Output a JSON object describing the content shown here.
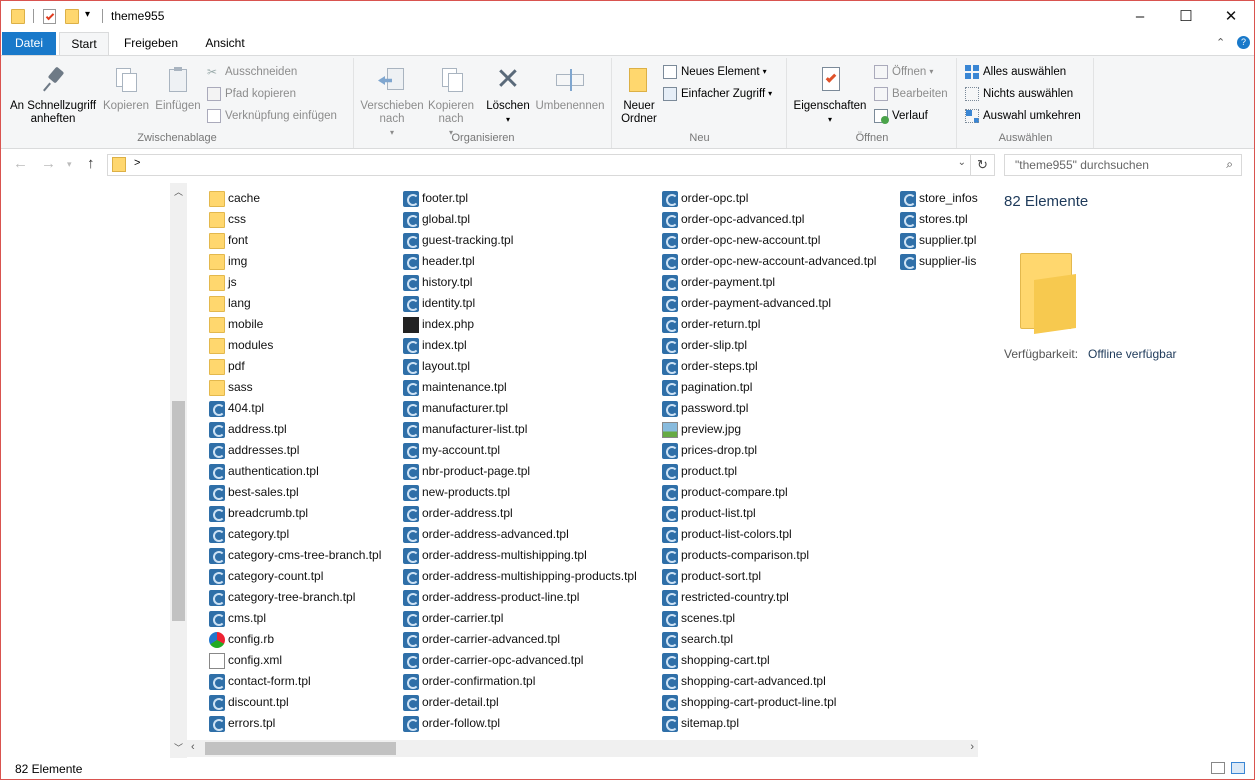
{
  "window": {
    "title": "theme955",
    "minimize": "–",
    "maximize": "☐",
    "close": "✕"
  },
  "tabs": {
    "file": "Datei",
    "start": "Start",
    "share": "Freigeben",
    "view": "Ansicht"
  },
  "ribbon": {
    "clipboard": {
      "label": "Zwischenablage",
      "pin": "An Schnellzugriff anheften",
      "copy": "Kopieren",
      "paste": "Einfügen",
      "cut": "Ausschneiden",
      "copy_path": "Pfad kopieren",
      "paste_shortcut": "Verknüpfung einfügen"
    },
    "organize": {
      "label": "Organisieren",
      "move": "Verschieben nach",
      "copyto": "Kopieren nach",
      "delete": "Löschen",
      "rename": "Umbenennen"
    },
    "new": {
      "label": "Neu",
      "folder": "Neuer Ordner",
      "new_item": "Neues Element",
      "easy_access": "Einfacher Zugriff"
    },
    "open": {
      "label": "Öffnen",
      "properties": "Eigenschaften",
      "open": "Öffnen",
      "edit": "Bearbeiten",
      "history": "Verlauf"
    },
    "select": {
      "label": "Auswählen",
      "all": "Alles auswählen",
      "none": "Nichts auswählen",
      "invert": "Auswahl umkehren"
    }
  },
  "address": {
    "path": ">",
    "search_placeholder": "\"theme955\" durchsuchen"
  },
  "files": {
    "col1": [
      {
        "name": "cache",
        "type": "folder"
      },
      {
        "name": "css",
        "type": "folder"
      },
      {
        "name": "font",
        "type": "folder"
      },
      {
        "name": "img",
        "type": "folder"
      },
      {
        "name": "js",
        "type": "folder"
      },
      {
        "name": "lang",
        "type": "folder"
      },
      {
        "name": "mobile",
        "type": "folder"
      },
      {
        "name": "modules",
        "type": "folder"
      },
      {
        "name": "pdf",
        "type": "folder"
      },
      {
        "name": "sass",
        "type": "folder"
      },
      {
        "name": "404.tpl",
        "type": "tpl"
      },
      {
        "name": "address.tpl",
        "type": "tpl"
      },
      {
        "name": "addresses.tpl",
        "type": "tpl"
      },
      {
        "name": "authentication.tpl",
        "type": "tpl"
      },
      {
        "name": "best-sales.tpl",
        "type": "tpl"
      },
      {
        "name": "breadcrumb.tpl",
        "type": "tpl"
      },
      {
        "name": "category.tpl",
        "type": "tpl"
      },
      {
        "name": "category-cms-tree-branch.tpl",
        "type": "tpl"
      },
      {
        "name": "category-count.tpl",
        "type": "tpl"
      },
      {
        "name": "category-tree-branch.tpl",
        "type": "tpl"
      },
      {
        "name": "cms.tpl",
        "type": "tpl"
      },
      {
        "name": "config.rb",
        "type": "rb"
      },
      {
        "name": "config.xml",
        "type": "xml"
      },
      {
        "name": "contact-form.tpl",
        "type": "tpl"
      },
      {
        "name": "discount.tpl",
        "type": "tpl"
      },
      {
        "name": "errors.tpl",
        "type": "tpl"
      }
    ],
    "col2": [
      {
        "name": "footer.tpl",
        "type": "tpl"
      },
      {
        "name": "global.tpl",
        "type": "tpl"
      },
      {
        "name": "guest-tracking.tpl",
        "type": "tpl"
      },
      {
        "name": "header.tpl",
        "type": "tpl"
      },
      {
        "name": "history.tpl",
        "type": "tpl"
      },
      {
        "name": "identity.tpl",
        "type": "tpl"
      },
      {
        "name": "index.php",
        "type": "php"
      },
      {
        "name": "index.tpl",
        "type": "tpl"
      },
      {
        "name": "layout.tpl",
        "type": "tpl"
      },
      {
        "name": "maintenance.tpl",
        "type": "tpl"
      },
      {
        "name": "manufacturer.tpl",
        "type": "tpl"
      },
      {
        "name": "manufacturer-list.tpl",
        "type": "tpl"
      },
      {
        "name": "my-account.tpl",
        "type": "tpl"
      },
      {
        "name": "nbr-product-page.tpl",
        "type": "tpl"
      },
      {
        "name": "new-products.tpl",
        "type": "tpl"
      },
      {
        "name": "order-address.tpl",
        "type": "tpl"
      },
      {
        "name": "order-address-advanced.tpl",
        "type": "tpl"
      },
      {
        "name": "order-address-multishipping.tpl",
        "type": "tpl"
      },
      {
        "name": "order-address-multishipping-products.tpl",
        "type": "tpl"
      },
      {
        "name": "order-address-product-line.tpl",
        "type": "tpl"
      },
      {
        "name": "order-carrier.tpl",
        "type": "tpl"
      },
      {
        "name": "order-carrier-advanced.tpl",
        "type": "tpl"
      },
      {
        "name": "order-carrier-opc-advanced.tpl",
        "type": "tpl"
      },
      {
        "name": "order-confirmation.tpl",
        "type": "tpl"
      },
      {
        "name": "order-detail.tpl",
        "type": "tpl"
      },
      {
        "name": "order-follow.tpl",
        "type": "tpl"
      }
    ],
    "col3": [
      {
        "name": "order-opc.tpl",
        "type": "tpl"
      },
      {
        "name": "order-opc-advanced.tpl",
        "type": "tpl"
      },
      {
        "name": "order-opc-new-account.tpl",
        "type": "tpl"
      },
      {
        "name": "order-opc-new-account-advanced.tpl",
        "type": "tpl"
      },
      {
        "name": "order-payment.tpl",
        "type": "tpl"
      },
      {
        "name": "order-payment-advanced.tpl",
        "type": "tpl"
      },
      {
        "name": "order-return.tpl",
        "type": "tpl"
      },
      {
        "name": "order-slip.tpl",
        "type": "tpl"
      },
      {
        "name": "order-steps.tpl",
        "type": "tpl"
      },
      {
        "name": "pagination.tpl",
        "type": "tpl"
      },
      {
        "name": "password.tpl",
        "type": "tpl"
      },
      {
        "name": "preview.jpg",
        "type": "jpg"
      },
      {
        "name": "prices-drop.tpl",
        "type": "tpl"
      },
      {
        "name": "product.tpl",
        "type": "tpl"
      },
      {
        "name": "product-compare.tpl",
        "type": "tpl"
      },
      {
        "name": "product-list.tpl",
        "type": "tpl"
      },
      {
        "name": "product-list-colors.tpl",
        "type": "tpl"
      },
      {
        "name": "products-comparison.tpl",
        "type": "tpl"
      },
      {
        "name": "product-sort.tpl",
        "type": "tpl"
      },
      {
        "name": "restricted-country.tpl",
        "type": "tpl"
      },
      {
        "name": "scenes.tpl",
        "type": "tpl"
      },
      {
        "name": "search.tpl",
        "type": "tpl"
      },
      {
        "name": "shopping-cart.tpl",
        "type": "tpl"
      },
      {
        "name": "shopping-cart-advanced.tpl",
        "type": "tpl"
      },
      {
        "name": "shopping-cart-product-line.tpl",
        "type": "tpl"
      },
      {
        "name": "sitemap.tpl",
        "type": "tpl"
      }
    ],
    "col4": [
      {
        "name": "store_infos.",
        "type": "tpl"
      },
      {
        "name": "stores.tpl",
        "type": "tpl"
      },
      {
        "name": "supplier.tpl",
        "type": "tpl"
      },
      {
        "name": "supplier-lis",
        "type": "tpl"
      }
    ]
  },
  "preview_pane": {
    "count": "82 Elemente",
    "availability_label": "Verfügbarkeit:",
    "availability_value": "Offline verfügbar"
  },
  "status": {
    "count": "82 Elemente"
  },
  "colors": {
    "accent": "#1979ca",
    "folder": "#ffd76e"
  }
}
